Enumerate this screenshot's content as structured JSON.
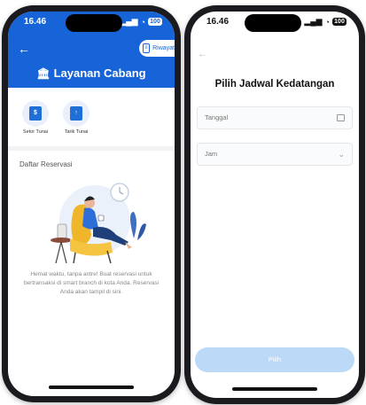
{
  "left_screen": {
    "status": {
      "time": "16.46",
      "battery": "100"
    },
    "header": {
      "history_label": "Riwayat",
      "title": "Layanan Cabang"
    },
    "menu": [
      {
        "label": "Setor Tunai",
        "icon": "cash-deposit-icon"
      },
      {
        "label": "Tarik Tunai",
        "icon": "cash-withdraw-icon"
      }
    ],
    "section_title": "Daftar Reservasi",
    "empty_message": "Hemat waktu, tanpa antre! Buat reservasi untuk bertransaksi di smart branch di kota Anda. Reservasi Anda akan tampil di sini."
  },
  "right_screen": {
    "status": {
      "time": "16.46",
      "battery": "100"
    },
    "title": "Pilih Jadwal Kedatangan",
    "date_placeholder": "Tanggal",
    "time_placeholder": "Jam",
    "submit_label": "Pilih"
  },
  "colors": {
    "primary": "#1764d8",
    "button_disabled": "#bcd9f7"
  }
}
